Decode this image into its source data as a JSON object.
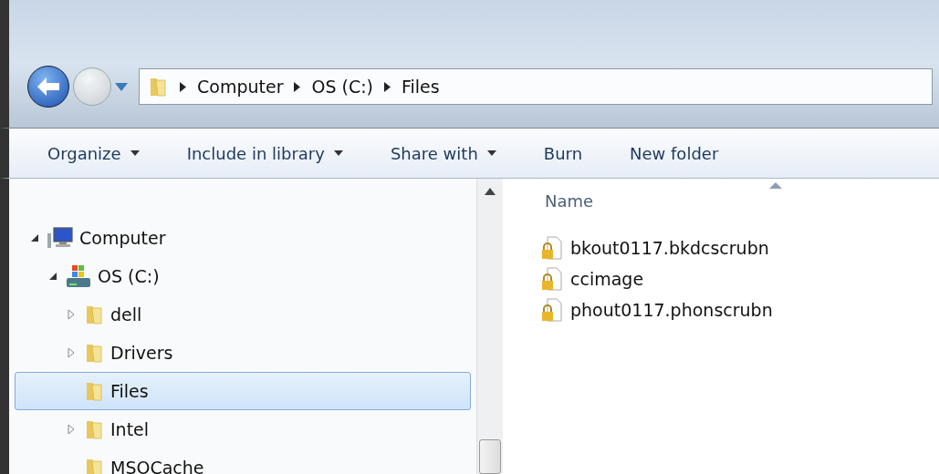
{
  "address_bar": {
    "crumbs": [
      "Computer",
      "OS (C:)",
      "Files"
    ]
  },
  "toolbar": [
    {
      "label": "Organize",
      "has_menu": true
    },
    {
      "label": "Include in library",
      "has_menu": true
    },
    {
      "label": "Share with",
      "has_menu": true
    },
    {
      "label": "Burn",
      "has_menu": false
    },
    {
      "label": "New folder",
      "has_menu": false
    }
  ],
  "navigation_tree": [
    {
      "label": "Computer",
      "kind": "computer",
      "expanded": true,
      "selected": false,
      "children": [
        {
          "label": "OS (C:)",
          "kind": "drive",
          "expanded": true,
          "selected": false,
          "children": [
            {
              "label": "dell",
              "kind": "folder",
              "expandable": true,
              "selected": false
            },
            {
              "label": "Drivers",
              "kind": "folder",
              "expandable": true,
              "selected": false
            },
            {
              "label": "Files",
              "kind": "folder",
              "expandable": false,
              "selected": true
            },
            {
              "label": "Intel",
              "kind": "folder",
              "expandable": true,
              "selected": false
            },
            {
              "label": "MSOCache",
              "kind": "folder",
              "expandable": false,
              "selected": false
            }
          ]
        }
      ]
    }
  ],
  "file_list": {
    "columns": [
      "Name"
    ],
    "files": [
      {
        "name": "bkout0117.bkdcscrubn"
      },
      {
        "name": "ccimage"
      },
      {
        "name": "phout0117.phonscrubn"
      }
    ]
  }
}
